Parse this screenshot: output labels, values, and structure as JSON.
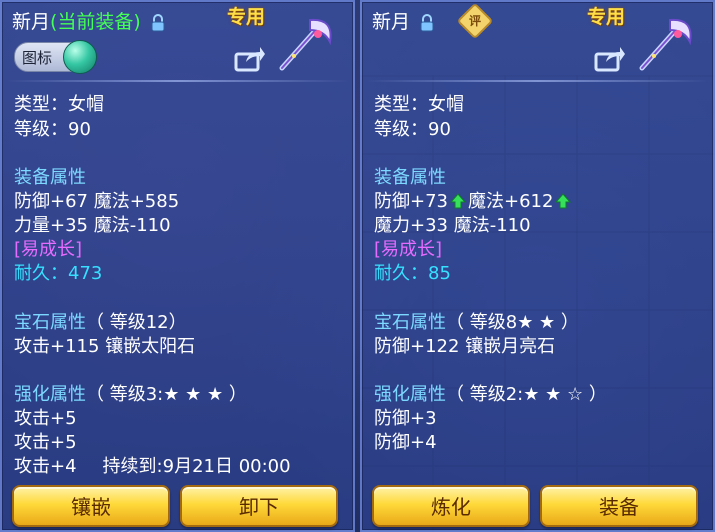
{
  "left": {
    "title_prefix": "新月",
    "title_status": "(当前装备)",
    "exclusive_label": "专用",
    "icon_toggle_label": "图标",
    "type_line": "类型：女帽",
    "level_line": "等级：90",
    "equip_attr_header": "装备属性",
    "attr_line1": "防御+67 魔法+585",
    "attr_line2": "力量+35 魔法-110",
    "special_tag": "[易成长]",
    "durability_line": "耐久：473",
    "gem_header": "宝石属性",
    "gem_level": "（ 等级12）",
    "gem_line": "攻击+115 镶嵌太阳石",
    "enhance_header": "强化属性",
    "enhance_level": "（ 等级3:",
    "enhance_stars": "★ ★ ★ ）",
    "enhance_line1": "攻击+5",
    "enhance_line2": "攻击+5",
    "enhance_line3": "攻击+4",
    "duration_line": "持续到:9月21日 00:00",
    "btn1": "镶嵌",
    "btn2": "卸下"
  },
  "right": {
    "title_prefix": "新月",
    "eval_badge": "评",
    "exclusive_label": "专用",
    "type_line": "类型：女帽",
    "level_line": "等级：90",
    "equip_attr_header": "装备属性",
    "attr_line1a": "防御+73",
    "attr_line1b": "魔法+612",
    "attr_line2": "魔力+33 魔法-110",
    "special_tag": "[易成长]",
    "durability_line": "耐久：85",
    "gem_header": "宝石属性",
    "gem_level": "（ 等级8",
    "gem_stars": "★ ★ ）",
    "gem_line": "防御+122 镶嵌月亮石",
    "enhance_header": "强化属性",
    "enhance_level": "（ 等级2:",
    "enhance_stars": "★ ★ ☆ ）",
    "enhance_line1": "防御+3",
    "enhance_line2": "防御+4",
    "btn1": "炼化",
    "btn2": "装备"
  },
  "colors": {
    "header_cyan": "#7dd8ff",
    "special_purple": "#e66bff",
    "durability_teal": "#37e0ff",
    "status_green": "#44ff55",
    "button_gold": "#ffd93a"
  },
  "icons": [
    "lock-icon",
    "share-icon",
    "weapon-icon",
    "up-arrow-icon",
    "eval-badge-icon"
  ]
}
